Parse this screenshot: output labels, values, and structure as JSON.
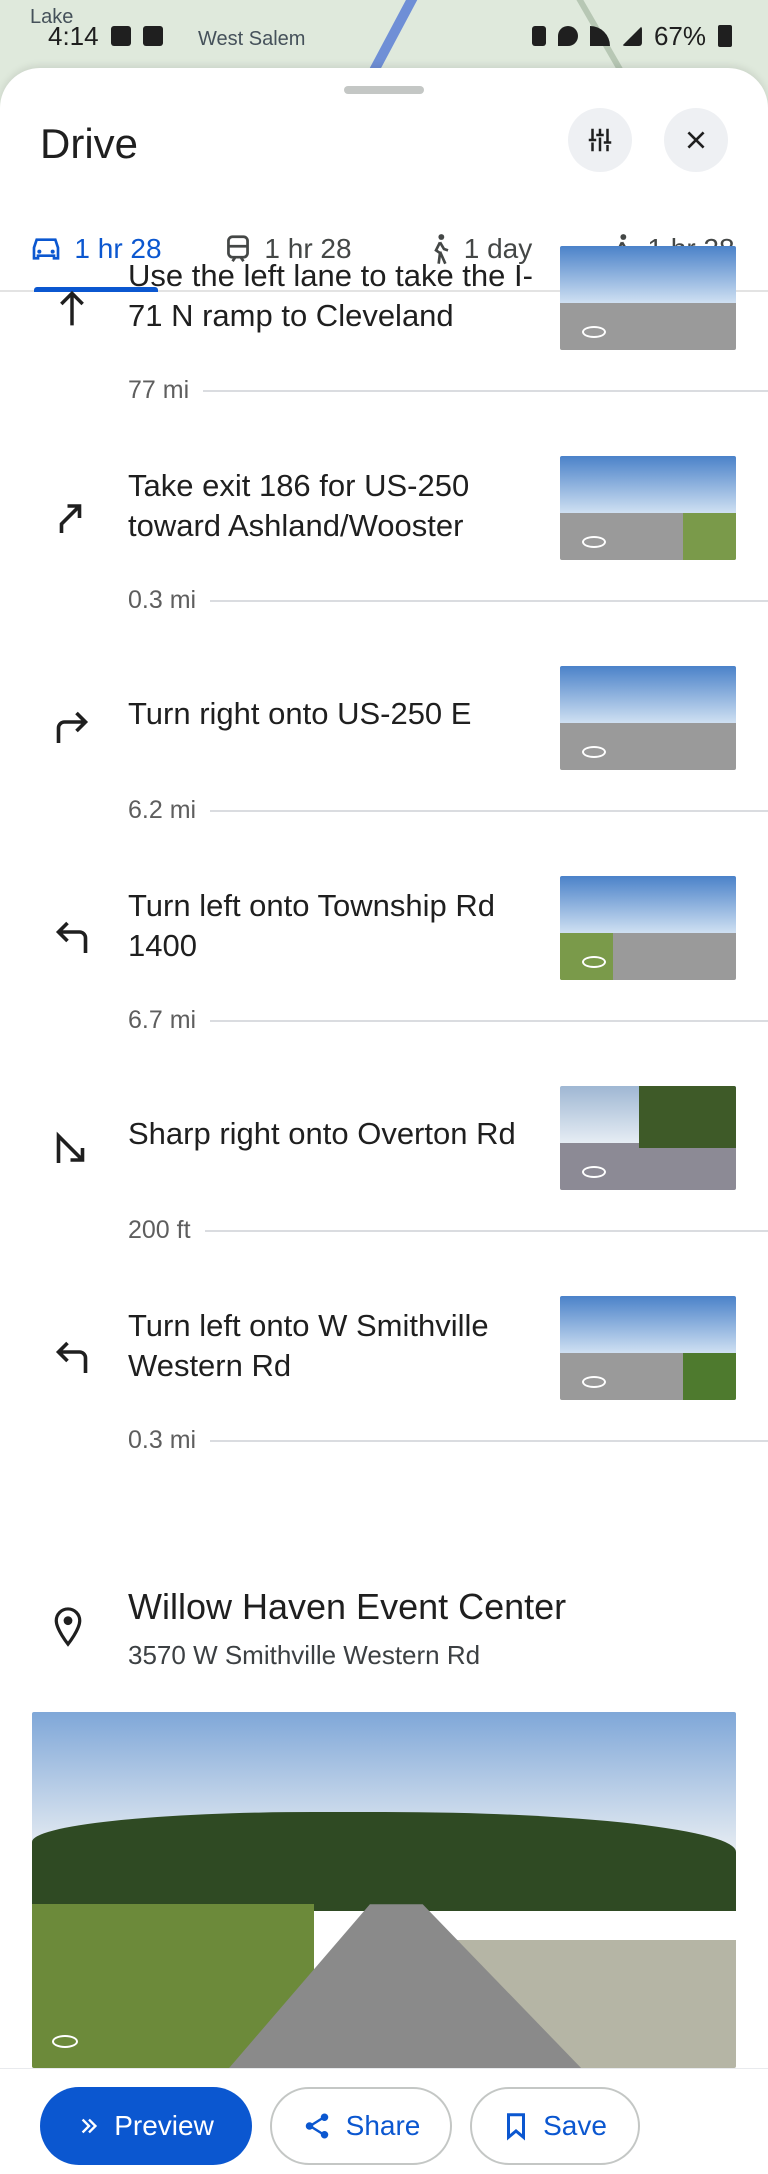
{
  "status_bar": {
    "time": "4:14",
    "battery": "67%",
    "map_labels": [
      "Lake",
      "West Salem"
    ]
  },
  "header": {
    "title": "Drive",
    "options_icon": "tune-icon",
    "close_icon": "close-icon"
  },
  "tabs": [
    {
      "icon": "car-icon",
      "label": "1 hr 28",
      "active": true
    },
    {
      "icon": "transit-icon",
      "label": "1 hr 28",
      "active": false
    },
    {
      "icon": "walk-icon",
      "label": "1 day",
      "active": false
    },
    {
      "icon": "hike-icon",
      "label": "1 hr 28",
      "active": false
    }
  ],
  "steps": [
    {
      "icon": "straight-arrow-icon",
      "text": "Use the left lane to take the I-71 N ramp to Cleveland",
      "distance": "77 mi"
    },
    {
      "icon": "slight-right-arrow-icon",
      "text": "Take exit 186 for US-250 toward Ashland/Wooster",
      "distance": "0.3 mi"
    },
    {
      "icon": "turn-right-arrow-icon",
      "text": "Turn right onto US-250 E",
      "distance": "6.2 mi"
    },
    {
      "icon": "turn-left-arrow-icon",
      "text": "Turn left onto Township Rd 1400",
      "distance": "6.7 mi"
    },
    {
      "icon": "sharp-right-arrow-icon",
      "text": "Sharp right onto Overton Rd",
      "distance": "200 ft"
    },
    {
      "icon": "turn-left-arrow-icon",
      "text": "Turn left onto W Smithville Western Rd",
      "distance": "0.3 mi"
    }
  ],
  "destination": {
    "icon": "location-pin-icon",
    "name": "Willow Haven Event Center",
    "address": "3570 W Smithville Western Rd"
  },
  "actions": {
    "preview": "Preview",
    "share": "Share",
    "save": "Save"
  },
  "colors": {
    "accent": "#0b57d0",
    "text": "#1f1f1f"
  }
}
